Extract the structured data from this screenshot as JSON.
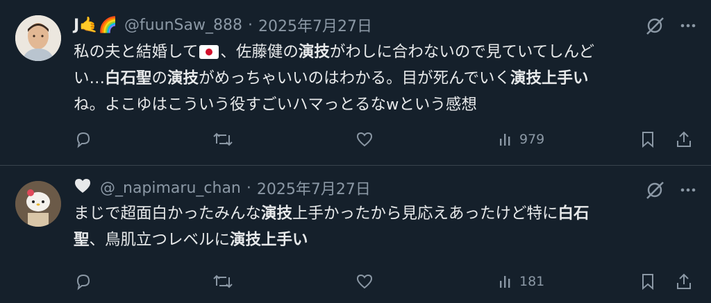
{
  "tweets": [
    {
      "display_name_emoji": "J🤙🌈",
      "handle": "@fuunSaw_888",
      "separator": "·",
      "date": "2025年7月27日",
      "body_lines": [
        [
          "私の夫と結婚して",
          "flag",
          "、佐藤健の",
          "B:演技",
          "がわしに合わないので見ていてしんど"
        ],
        [
          "い…",
          "B:白石聖",
          "の",
          "B:演技",
          "がめっちゃいいのはわかる。目が死んでいく",
          "B:演技上手い"
        ],
        [
          "ね。よこゆはこういう役すごいハマっとるなwという感想"
        ]
      ],
      "line1_a": "私の夫と結婚して",
      "line1_b": "、佐藤健の",
      "line1_c": "演技",
      "line1_d": "がわしに合わないので見ていてしんど",
      "line2_a": "い…",
      "line2_b": "白石聖",
      "line2_c": "の",
      "line2_d": "演技",
      "line2_e": "がめっちゃいいのはわかる。目が死んでいく",
      "line2_f": "演技上手い",
      "line3": "ね。よこゆはこういう役すごいハマっとるなwという感想",
      "views": "979"
    },
    {
      "handle": "@_napimaru_chan",
      "separator": "·",
      "date": "2025年7月27日",
      "line1_a": "まじで超面白かったみんな",
      "line1_b": "演技",
      "line1_c": "上手かったから見応えあったけど特に",
      "line1_d": "白石",
      "line2_a": "聖",
      "line2_b": "、鳥肌立つレベルに",
      "line2_c": "演技上手い",
      "views": "181"
    }
  ],
  "icons": {
    "grok": "grok-icon",
    "more": "more-icon",
    "reply": "reply-icon",
    "retweet": "retweet-icon",
    "like": "like-icon",
    "views": "views-icon",
    "bookmark": "bookmark-icon",
    "share": "share-icon"
  },
  "colors": {
    "background": "#15202b",
    "text": "#e7e9ea",
    "secondary": "#8b98a5",
    "divider": "#38444d"
  }
}
